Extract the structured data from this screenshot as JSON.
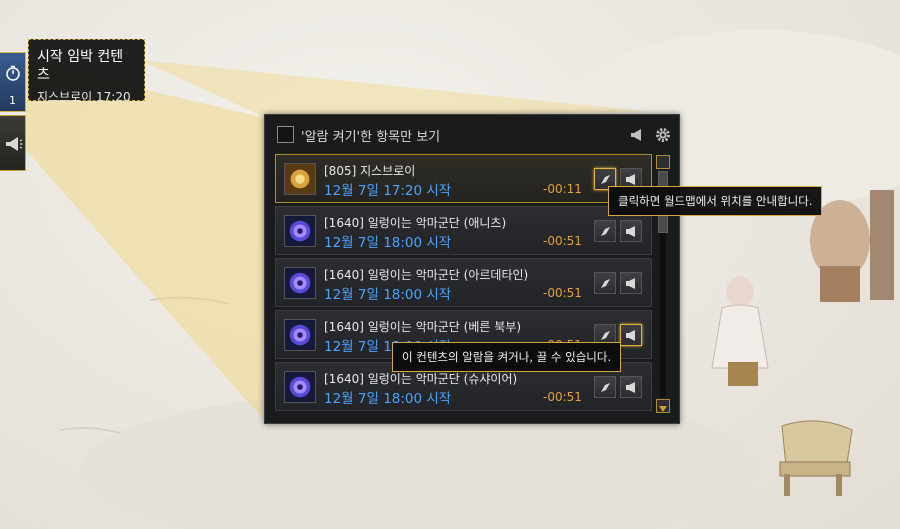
{
  "upcoming": {
    "title": "시작 임박 컨텐츠",
    "detail": "지스브로이  17:20",
    "count": "1"
  },
  "panel": {
    "filter_label": "'알람 켜기'한 항목만 보기",
    "rows": [
      {
        "name": "[805] 지스브로이",
        "date": "12월 7일 17:20 시작",
        "remain": "-00:11",
        "thumb": "gold"
      },
      {
        "name": "[1640] 일렁이는 악마군단 (애니츠)",
        "date": "12월 7일 18:00 시작",
        "remain": "-00:51",
        "thumb": "portal"
      },
      {
        "name": "[1640] 일렁이는 악마군단 (아르데타인)",
        "date": "12월 7일 18:00 시작",
        "remain": "-00:51",
        "thumb": "portal"
      },
      {
        "name": "[1640] 일렁이는 악마군단 (베른 북부)",
        "date": "12월 7일 18:00 시작",
        "remain": "-00:51",
        "thumb": "portal"
      },
      {
        "name": "[1640] 일렁이는 악마군단 (슈샤이어)",
        "date": "12월 7일 18:00 시작",
        "remain": "-00:51",
        "thumb": "portal"
      }
    ]
  },
  "tooltips": {
    "map": "클릭하면 월드맵에서 위치를 안내합니다.",
    "alarm": "이 컨텐츠의 알람을 켜거나, 끌 수 있습니다."
  },
  "colors": {
    "accent_gold": "#d6a73a",
    "date_blue": "#4aa3ff",
    "remain_orange": "#e0a23a"
  }
}
